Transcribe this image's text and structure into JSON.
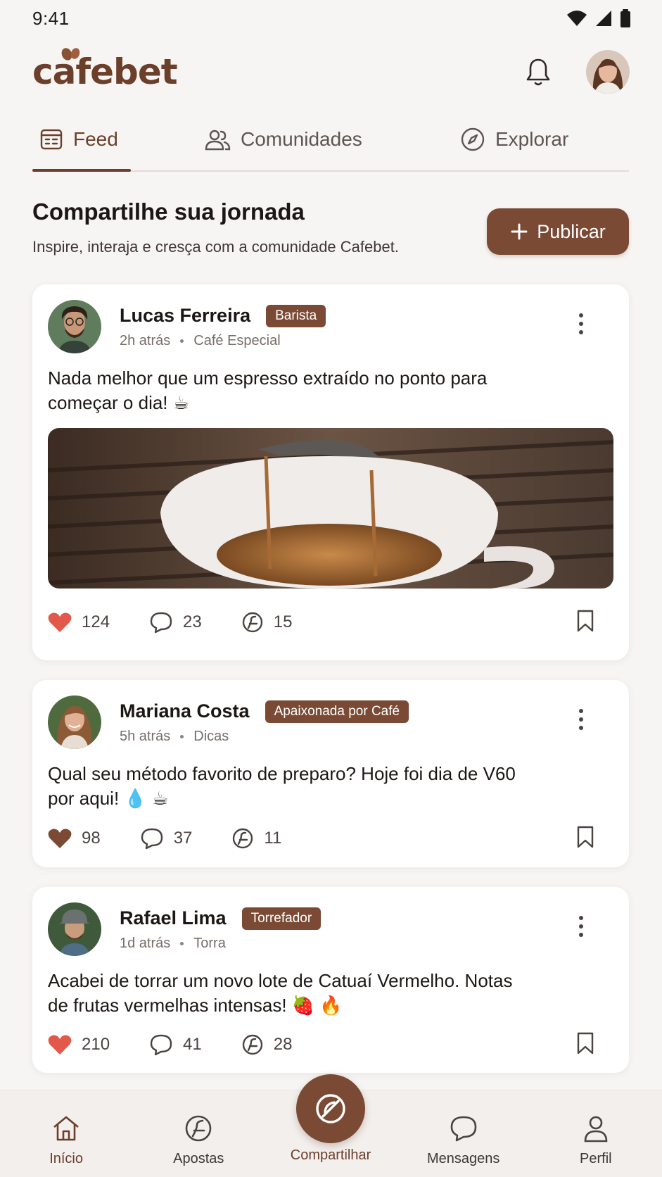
{
  "status_bar": {
    "time": "9:41"
  },
  "header": {
    "logo": "cafebet"
  },
  "tabs": [
    {
      "label": "Feed",
      "icon": "feed-icon",
      "active": true
    },
    {
      "label": "Comunidades",
      "icon": "users-icon",
      "active": false
    },
    {
      "label": "Explorar",
      "icon": "compass-icon",
      "active": false
    }
  ],
  "share": {
    "title": "Compartilhe sua jornada",
    "subtitle": "Inspire, interaja e cresça com a comunidade Cafebet.",
    "publish_label": "Publicar"
  },
  "posts": [
    {
      "author": "Lucas Ferreira",
      "badge": "Barista",
      "time": "2h atrás",
      "category": "Café Especial",
      "text": "Nada melhor que um espresso extraído no ponto para começar o dia! ☕",
      "likes": "124",
      "comments": "23",
      "shares": "15",
      "liked": true,
      "has_image": true
    },
    {
      "author": "Mariana Costa",
      "badge": "Apaixonada por Café",
      "time": "5h atrás",
      "category": "Dicas",
      "text": "Qual seu método favorito de preparo? Hoje foi dia de V60 por aqui! 💧 ☕",
      "likes": "98",
      "comments": "37",
      "shares": "11",
      "liked": false,
      "has_image": false
    },
    {
      "author": "Rafael Lima",
      "badge": "Torrefador",
      "time": "1d atrás",
      "category": "Torra",
      "text": "Acabei de torrar um novo lote de Catuaí Vermelho. Notas de frutas vermelhas intensas! 🍓 🔥",
      "likes": "210",
      "comments": "41",
      "shares": "28",
      "liked": true,
      "has_image": false
    }
  ],
  "bottom_nav": {
    "inicio": "Início",
    "apostas": "Apostas",
    "compartilhar": "Compartilhar",
    "mensagens": "Mensagens",
    "perfil": "Perfil"
  },
  "colors": {
    "brand": "#7a4a35",
    "brand_dark": "#6b3f2a",
    "like_active": "#e2584a",
    "like_muted": "#7a4a35",
    "background": "#f7f5f4"
  }
}
